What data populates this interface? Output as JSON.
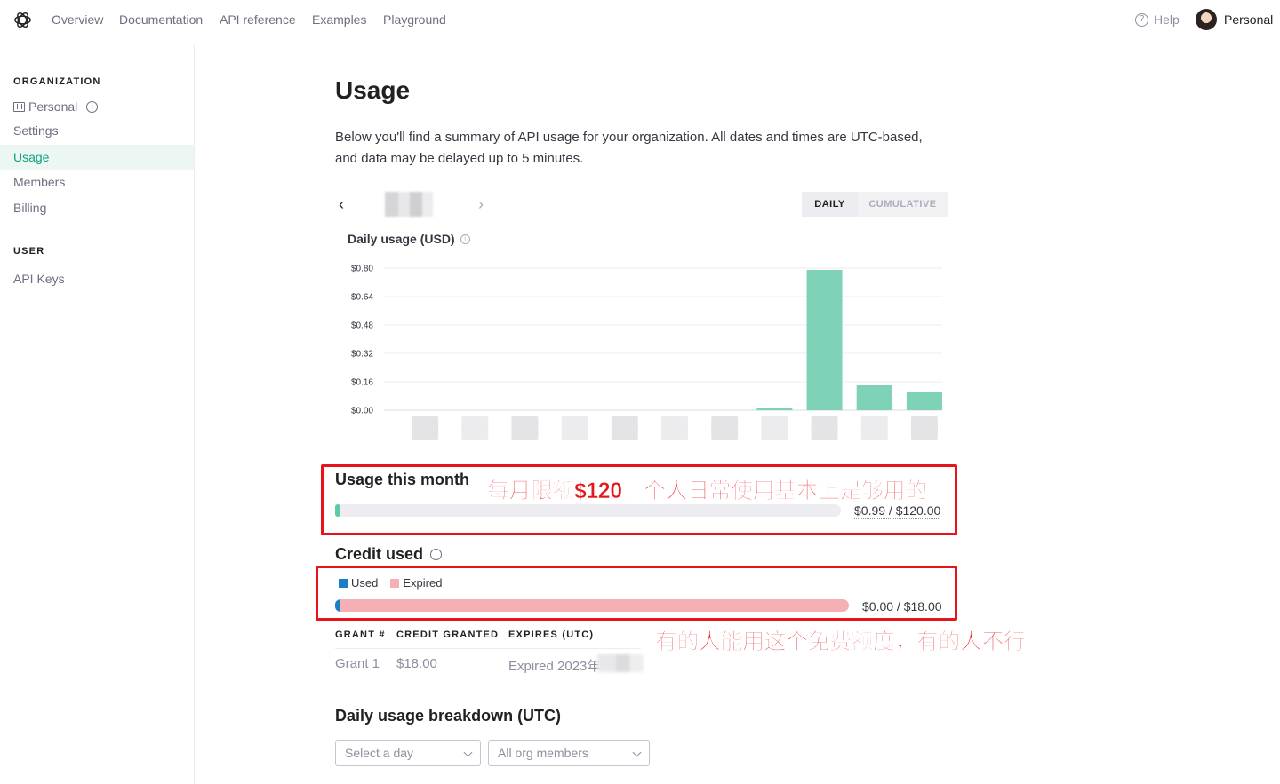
{
  "topnav": {
    "links": [
      "Overview",
      "Documentation",
      "API reference",
      "Examples",
      "Playground"
    ],
    "help_label": "Help",
    "user_label": "Personal"
  },
  "sidebar": {
    "org_heading": "ORGANIZATION",
    "org_name": "Personal",
    "items": [
      "Settings",
      "Usage",
      "Members",
      "Billing"
    ],
    "active_item": "Usage",
    "user_heading": "USER",
    "user_items": [
      "API Keys"
    ]
  },
  "page": {
    "title": "Usage",
    "description": "Below you'll find a summary of API usage for your organization. All dates and times are UTC-based, and data may be delayed up to 5 minutes."
  },
  "toggle": {
    "daily": "DAILY",
    "cumulative": "CUMULATIVE",
    "selected": "DAILY"
  },
  "chart_data": {
    "type": "bar",
    "title": "Daily usage (USD)",
    "yticks": [
      "$0.80",
      "$0.64",
      "$0.48",
      "$0.32",
      "$0.16",
      "$0.00"
    ],
    "ylim": [
      0,
      0.8
    ],
    "values": [
      0,
      0,
      0,
      0,
      0,
      0,
      0,
      0.01,
      0.79,
      0.14,
      0.1
    ],
    "xlabels_note": "obscured",
    "bar_color": "#7dd2b8",
    "grid": true
  },
  "usage_month": {
    "title": "Usage this month",
    "amount": "$0.99 / $120.00",
    "fraction": 0.0083,
    "fill_color": "#5ec9a6",
    "annotation": "每月限额$120。个人日常使用基本上是够用的"
  },
  "credit": {
    "title": "Credit used",
    "legend": [
      {
        "label": "Used",
        "color": "#1a7fc7"
      },
      {
        "label": "Expired",
        "color": "#f4b0b5"
      }
    ],
    "amount": "$0.00 / $18.00",
    "annotation": "有的人能用这个免费额度，有的人不行"
  },
  "grants": {
    "headers": [
      "GRANT #",
      "CREDIT GRANTED",
      "EXPIRES (UTC)"
    ],
    "rows": [
      {
        "grant": "Grant 1",
        "granted": "$18.00",
        "expires": "Expired 2023年"
      }
    ]
  },
  "breakdown": {
    "title": "Daily usage breakdown (UTC)",
    "day_select": "Select a day",
    "member_select": "All org members"
  }
}
